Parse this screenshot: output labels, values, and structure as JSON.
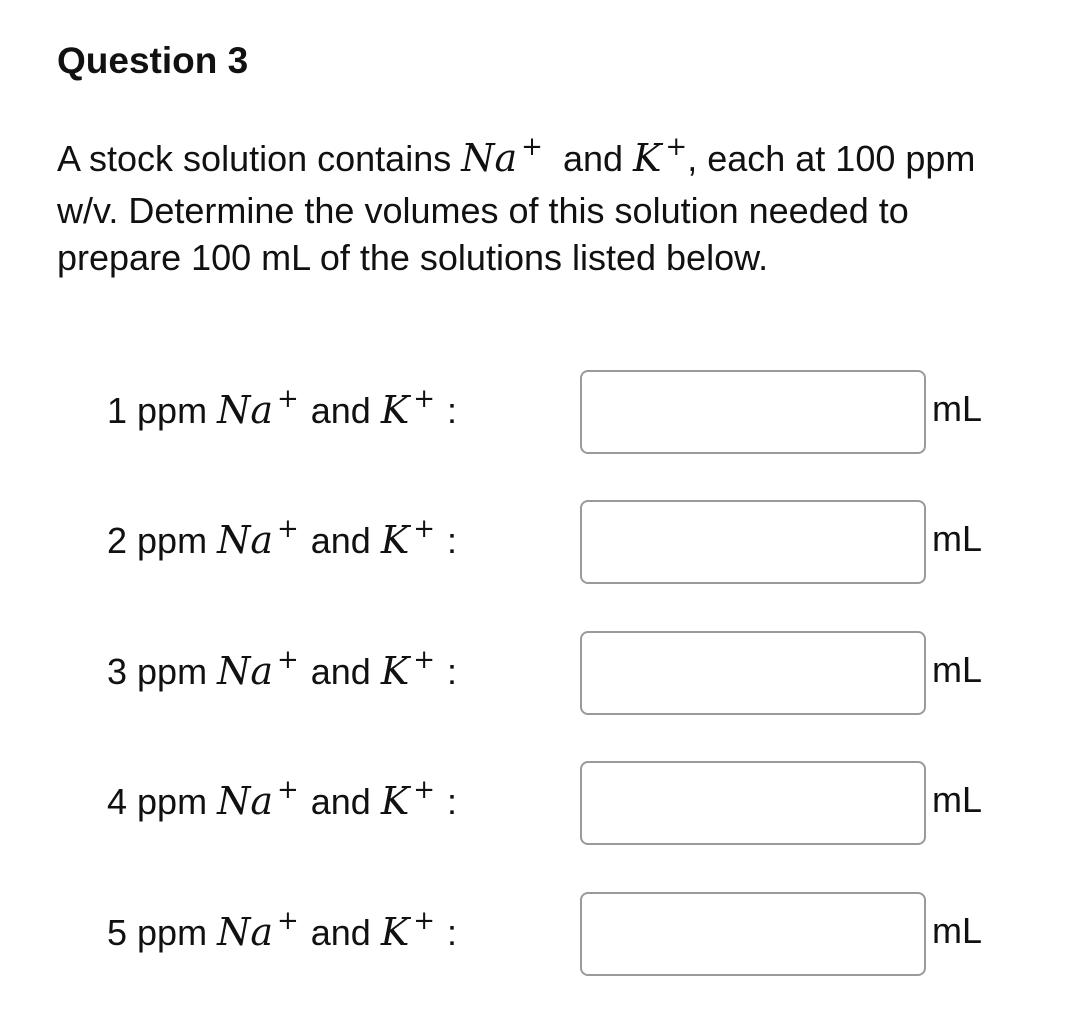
{
  "question": {
    "title": "Question 3",
    "intro_part1": "A stock solution contains ",
    "ion1": "Na",
    "ion2": "K",
    "charge": "+",
    "intro_and": " and ",
    "intro_part2": ", each at 100 ppm w/v. Determine the volumes of this solution needed to prepare 100 mL of the solutions listed below."
  },
  "rows": [
    {
      "prefix": "1 ppm ",
      "and": " and ",
      "colon": " :",
      "value": "",
      "unit": "mL"
    },
    {
      "prefix": "2 ppm ",
      "and": " and ",
      "colon": " :",
      "value": "",
      "unit": "mL"
    },
    {
      "prefix": "3 ppm ",
      "and": " and ",
      "colon": " :",
      "value": "",
      "unit": "mL"
    },
    {
      "prefix": "4 ppm ",
      "and": " and ",
      "colon": " :",
      "value": "",
      "unit": "mL"
    },
    {
      "prefix": "5 ppm ",
      "and": " and ",
      "colon": " :",
      "value": "",
      "unit": "mL"
    }
  ]
}
